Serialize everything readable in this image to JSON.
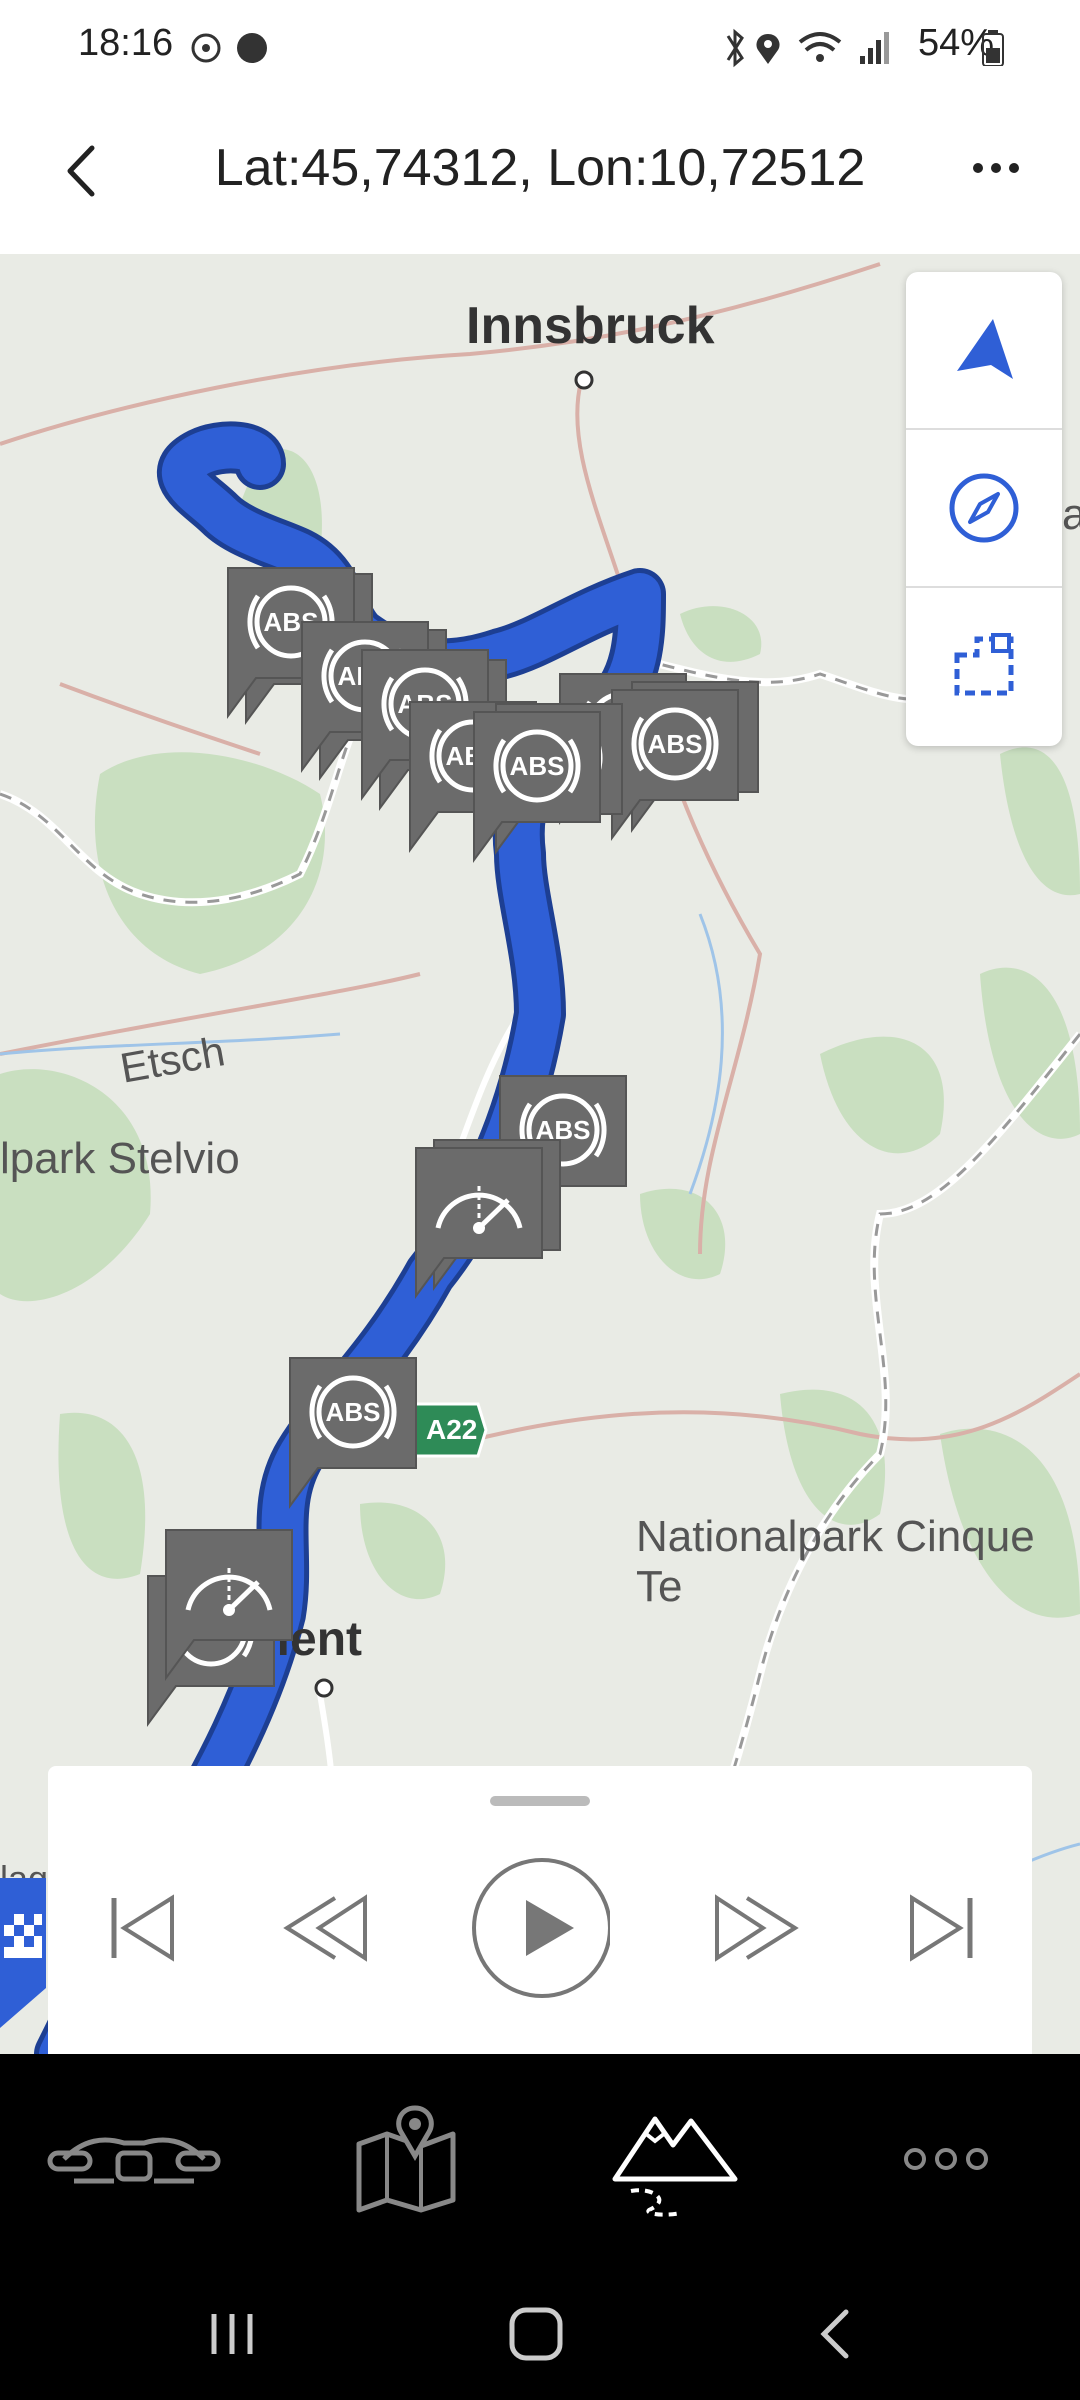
{
  "status_bar": {
    "time": "18:16",
    "battery": "54%"
  },
  "header": {
    "title": "Lat:45,74312, Lon:10,72512"
  },
  "map": {
    "labels": {
      "innsbruck": "Innsbruck",
      "etsch": "Etsch",
      "stelvio": "lpark Stelvio",
      "trient": "rient",
      "cinque": "Nationalpark Cinque Te",
      "highway": "A22",
      "edge_a": "a",
      "edge_lag": "lag"
    },
    "tools": [
      "navigation-arrow-icon",
      "compass-icon",
      "route-select-icon"
    ],
    "markers": {
      "abs": "ABS"
    }
  },
  "colors": {
    "route": "#2f5fd6",
    "accent": "#2f5fd6",
    "marker": "#6b6b6b",
    "forest": "#c9dfc0",
    "highway": "#2e8b57"
  },
  "controls": {
    "buttons": [
      "skip-start",
      "rewind",
      "play",
      "fast-forward",
      "skip-end"
    ]
  },
  "bottom_nav": [
    "motorcycle",
    "map",
    "mountain-routes",
    "more"
  ]
}
